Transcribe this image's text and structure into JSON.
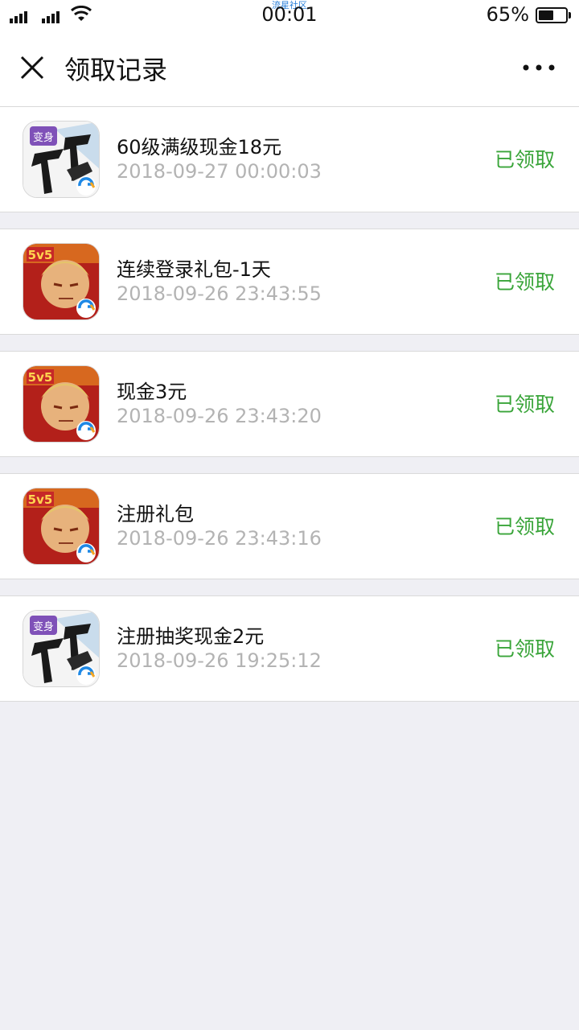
{
  "status_bar": {
    "watermark": "流星社区",
    "time": "00:01",
    "battery_percent": "65%",
    "battery_level": 0.65
  },
  "navbar": {
    "title": "领取记录",
    "close_icon": "close-icon",
    "more_icon": "more-dots-icon"
  },
  "records": [
    {
      "icon": "xuanyuan-game-icon",
      "title": "60级满级现金18元",
      "time": "2018-09-27 00:00:03",
      "status": "已领取"
    },
    {
      "icon": "honor-of-kings-game-icon",
      "title": "连续登录礼包-1天",
      "time": "2018-09-26 23:43:55",
      "status": "已领取"
    },
    {
      "icon": "honor-of-kings-game-icon",
      "title": "现金3元",
      "time": "2018-09-26 23:43:20",
      "status": "已领取"
    },
    {
      "icon": "honor-of-kings-game-icon",
      "title": "注册礼包",
      "time": "2018-09-26 23:43:16",
      "status": "已领取"
    },
    {
      "icon": "xuanyuan-game-icon",
      "title": "注册抽奖现金2元",
      "time": "2018-09-26 19:25:12",
      "status": "已领取"
    }
  ],
  "colors": {
    "status_green": "#3aa53a",
    "timestamp_gray": "#b3b3b3",
    "page_background": "#efeff4"
  }
}
